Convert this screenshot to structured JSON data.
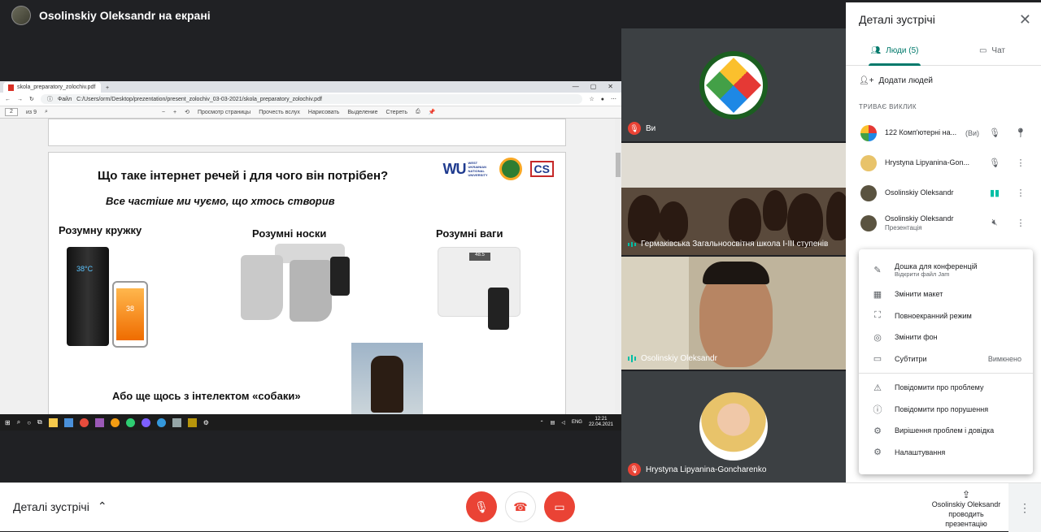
{
  "presenter": {
    "title": "Osolinskiy Oleksandr на екрані"
  },
  "browser": {
    "tab_label": "skola_preparatory_zolochiv.pdf",
    "new_tab": "+",
    "url_prefix": "Файл",
    "url": "C:/Users/orm/Desktop/prezentation/present_zolochiv_03-03-2021/skola_preparatory_zolochiv.pdf",
    "page_current": "2",
    "page_total": "из 9",
    "tools": [
      "Просмотр страницы",
      "Прочесть вслух",
      "Нарисовать",
      "Выделение",
      "Стереть"
    ]
  },
  "slide": {
    "title": "Що таке інтернет речей і для чого він потрібен?",
    "subtitle": "Все частіше ми чуємо, що хтось створив",
    "logo_wu": "WU",
    "logo_wu_text": "WEST UKRAINIAN NATIONAL UNIVERSITY",
    "logo_cs": "CS",
    "products": [
      {
        "label": "Розумну кружку"
      },
      {
        "label": "Розумні носки"
      },
      {
        "label": "Розумні ваги"
      }
    ],
    "mug_temp": "38°C",
    "phone_temp": "38",
    "scale_value": "48.5",
    "dog_text": "Або ще щось з інтелектом «собаки»"
  },
  "taskbar": {
    "lang": "ENG",
    "time": "12:21",
    "date": "22.04.2021"
  },
  "tiles": [
    {
      "name": "Ви",
      "muted": true
    },
    {
      "name": "Гермаківська Загальноосвітня школа І-ІІІ ступенів",
      "muted": false
    },
    {
      "name": "Osolinskiy Oleksandr",
      "muted": false
    },
    {
      "name": "Hrystyna Lipyanina-Goncharenko",
      "muted": true
    }
  ],
  "panel": {
    "title": "Деталі зустрічі",
    "close": "✕",
    "tab_people": "Люди (5)",
    "tab_chat": "Чат",
    "add_people": "Додати людей",
    "section": "ТРИВАЄ ВИКЛИК",
    "people": [
      {
        "name": "122 Комп'ютерні на...",
        "suffix": "(Ви)",
        "sub": ""
      },
      {
        "name": "Hrystyna Lipyanina-Gon...",
        "suffix": "",
        "sub": ""
      },
      {
        "name": "Osolinskiy Oleksandr",
        "suffix": "",
        "sub": ""
      },
      {
        "name": "Osolinskiy Oleksandr",
        "suffix": "",
        "sub": "Презентація"
      }
    ]
  },
  "menu": {
    "items": [
      {
        "label": "Дошка для конференцій",
        "sub": "Відкрити файл Jam"
      },
      {
        "label": "Змінити макет"
      },
      {
        "label": "Повноекранний режим"
      },
      {
        "label": "Змінити фон"
      },
      {
        "label": "Субтитри",
        "value": "Вимкнено"
      },
      {
        "label": "Повідомити про проблему"
      },
      {
        "label": "Повідомити про порушення"
      },
      {
        "label": "Вирішення проблем і довідка"
      },
      {
        "label": "Налаштування"
      }
    ]
  },
  "bottom": {
    "details": "Деталі зустрічі",
    "presenting_name": "Osolinskiy Oleksandr",
    "presenting_text": "проводить презентацію"
  },
  "colors": {
    "accent": "#00796b",
    "danger": "#ea4335",
    "speaking": "#00bfa5"
  }
}
